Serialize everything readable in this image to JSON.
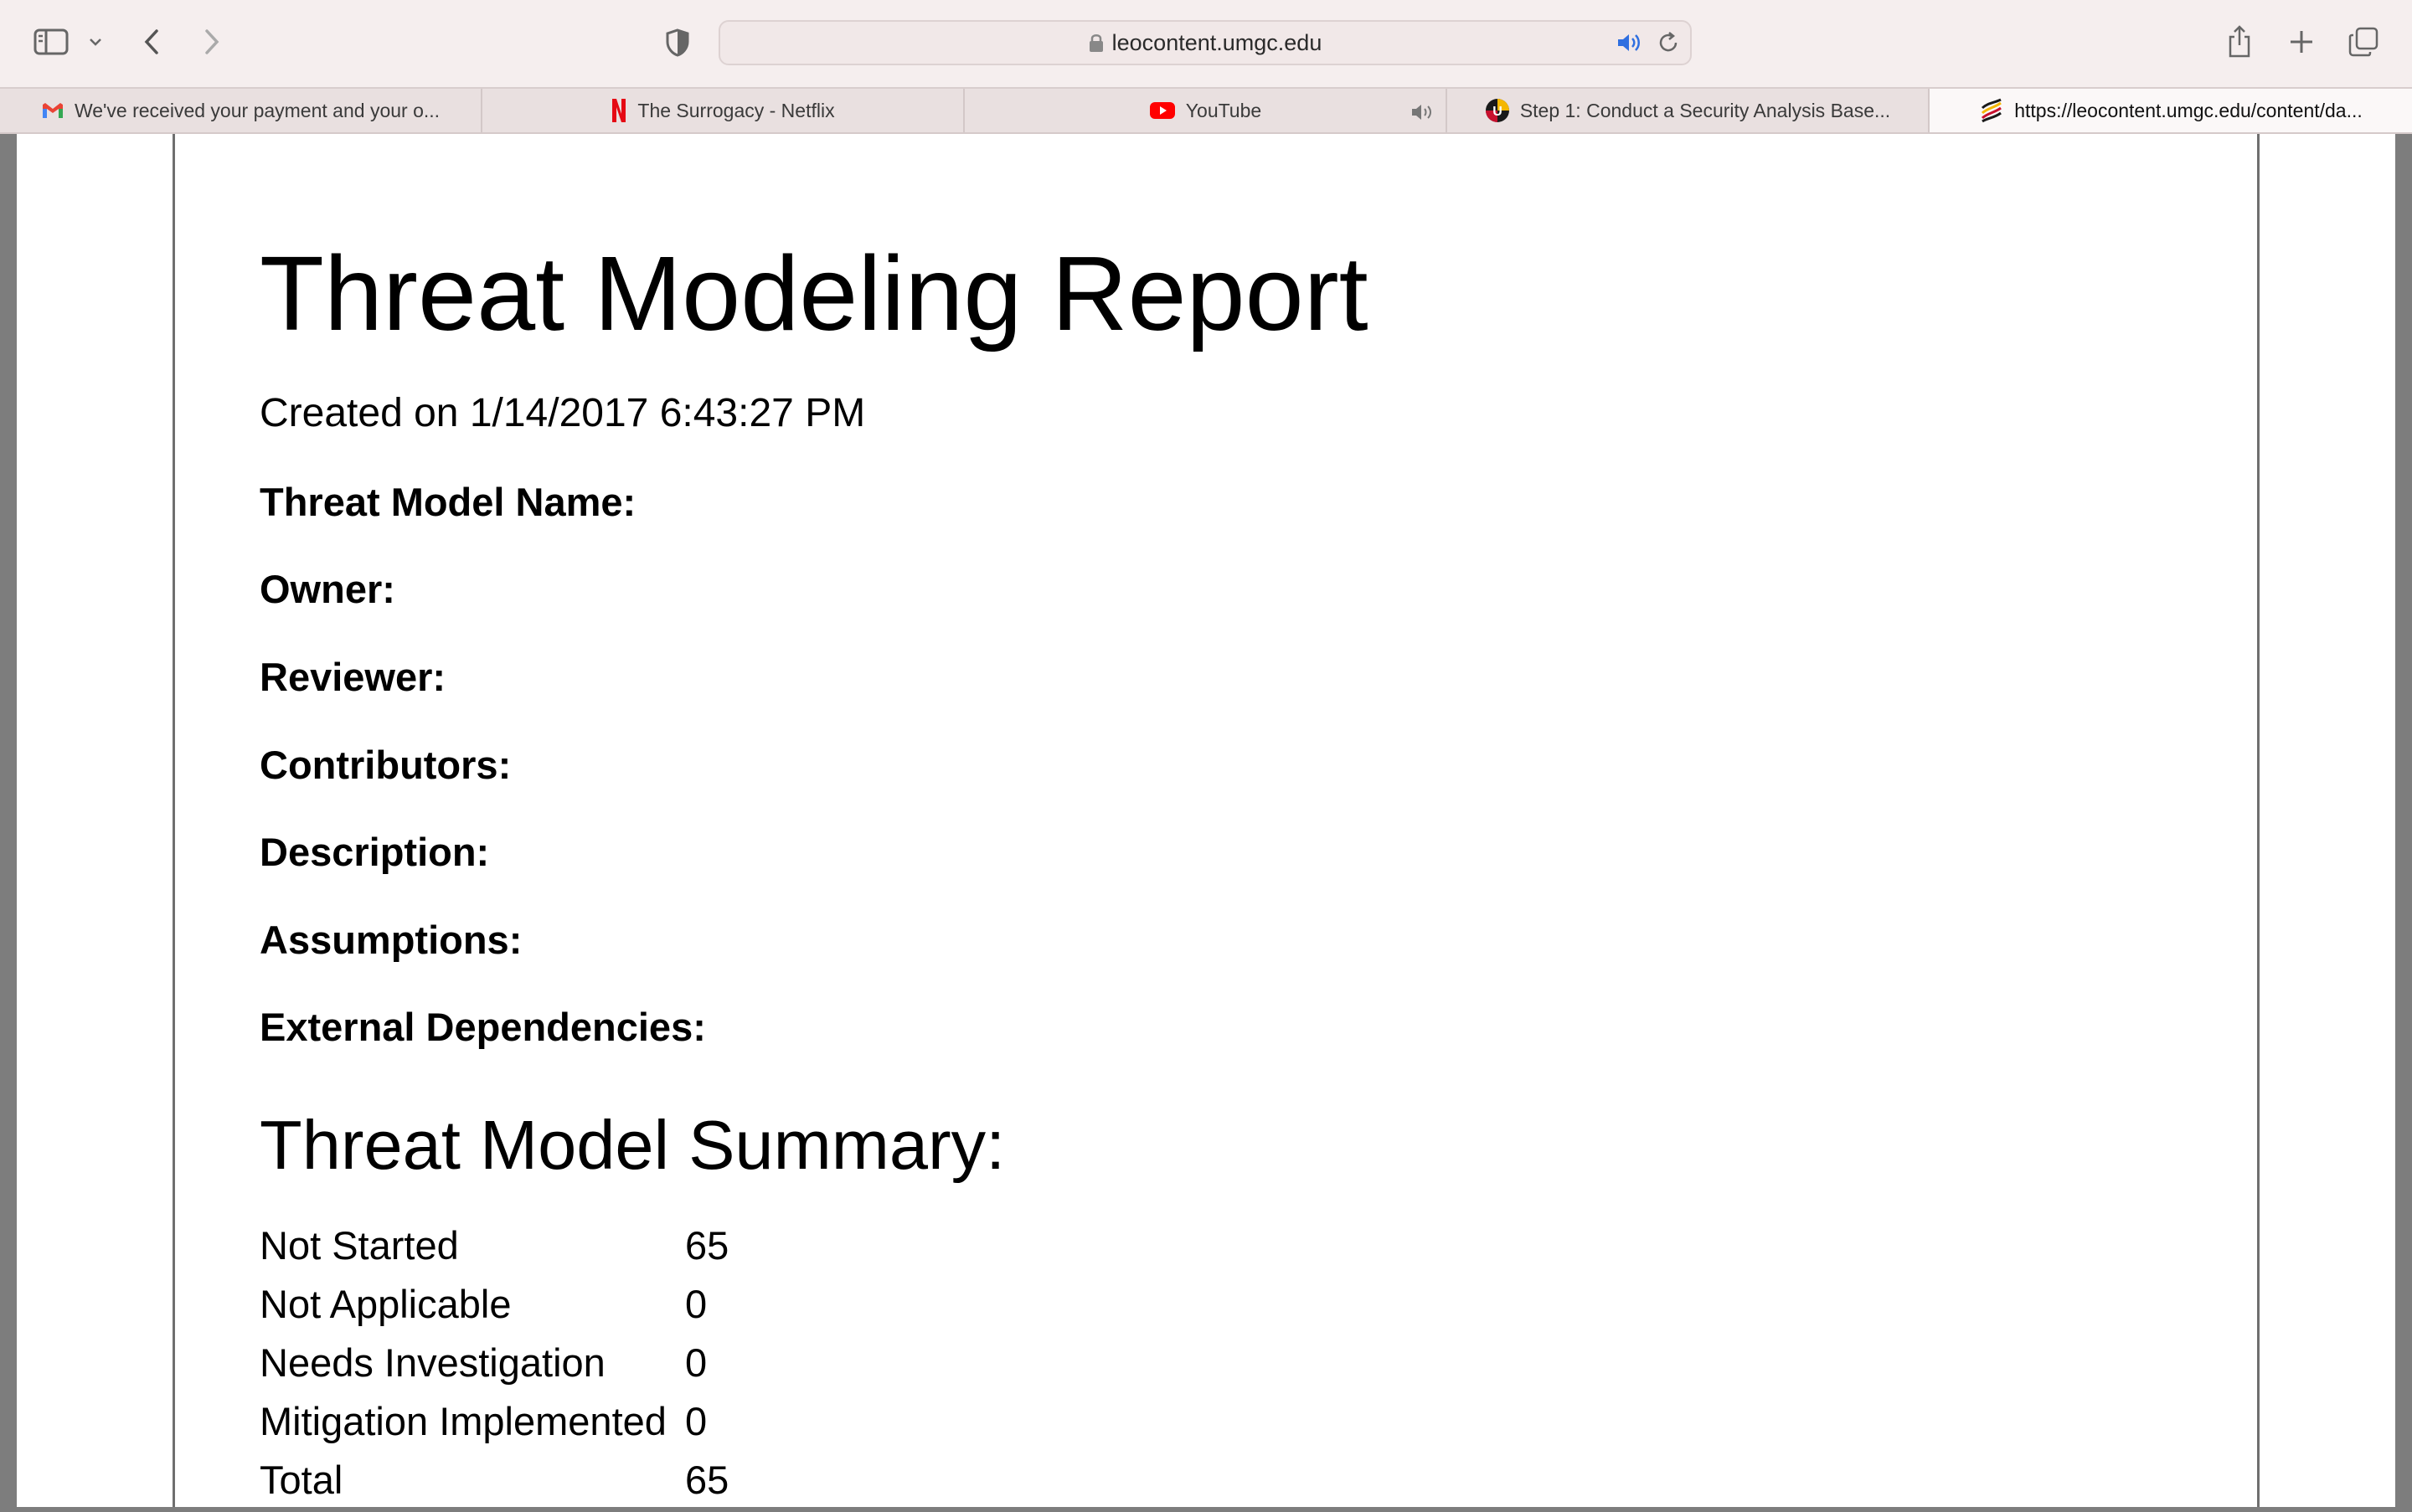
{
  "browser": {
    "address": "leocontent.umgc.edu",
    "tabs": [
      {
        "title": "We've received your payment and your o...",
        "favicon": "gmail-icon",
        "active": false,
        "audio": false
      },
      {
        "title": "The Surrogacy - Netflix",
        "favicon": "netflix-icon",
        "active": false,
        "audio": false
      },
      {
        "title": "YouTube",
        "favicon": "youtube-icon",
        "active": false,
        "audio": true
      },
      {
        "title": "Step 1: Conduct a Security Analysis Base...",
        "favicon": "umgc-icon",
        "active": false,
        "audio": false
      },
      {
        "title": "https://leocontent.umgc.edu/content/da...",
        "favicon": "umgc-flag-icon",
        "active": true,
        "audio": false
      }
    ],
    "icons": {
      "sidebar": "sidebar-icon",
      "dropdown": "chevron-down-icon",
      "back": "back-icon",
      "forward": "forward-icon",
      "privacy": "shield-icon",
      "lock": "lock-icon",
      "audio": "speaker-icon",
      "reload": "reload-icon",
      "share": "share-icon",
      "new_tab": "plus-icon",
      "tab_overview": "tabs-icon"
    },
    "colors": {
      "audio_accent": "#2f6fe0",
      "youtube": "#ff0000",
      "netflix": "#e50914"
    }
  },
  "report": {
    "title": "Threat Modeling Report",
    "created": "Created on 1/14/2017 6:43:27 PM",
    "fields": {
      "name": "Threat Model Name:",
      "owner": "Owner:",
      "reviewer": "Reviewer:",
      "contributors": "Contributors:",
      "description": "Description:",
      "assumptions": "Assumptions:",
      "dependencies": "External Dependencies:"
    },
    "summary_title": "Threat Model Summary:",
    "summary": [
      {
        "label": "Not Started",
        "value": "65"
      },
      {
        "label": "Not Applicable",
        "value": "0"
      },
      {
        "label": "Needs Investigation",
        "value": "0"
      },
      {
        "label": "Mitigation Implemented",
        "value": "0"
      },
      {
        "label": "Total",
        "value": "65"
      }
    ]
  }
}
